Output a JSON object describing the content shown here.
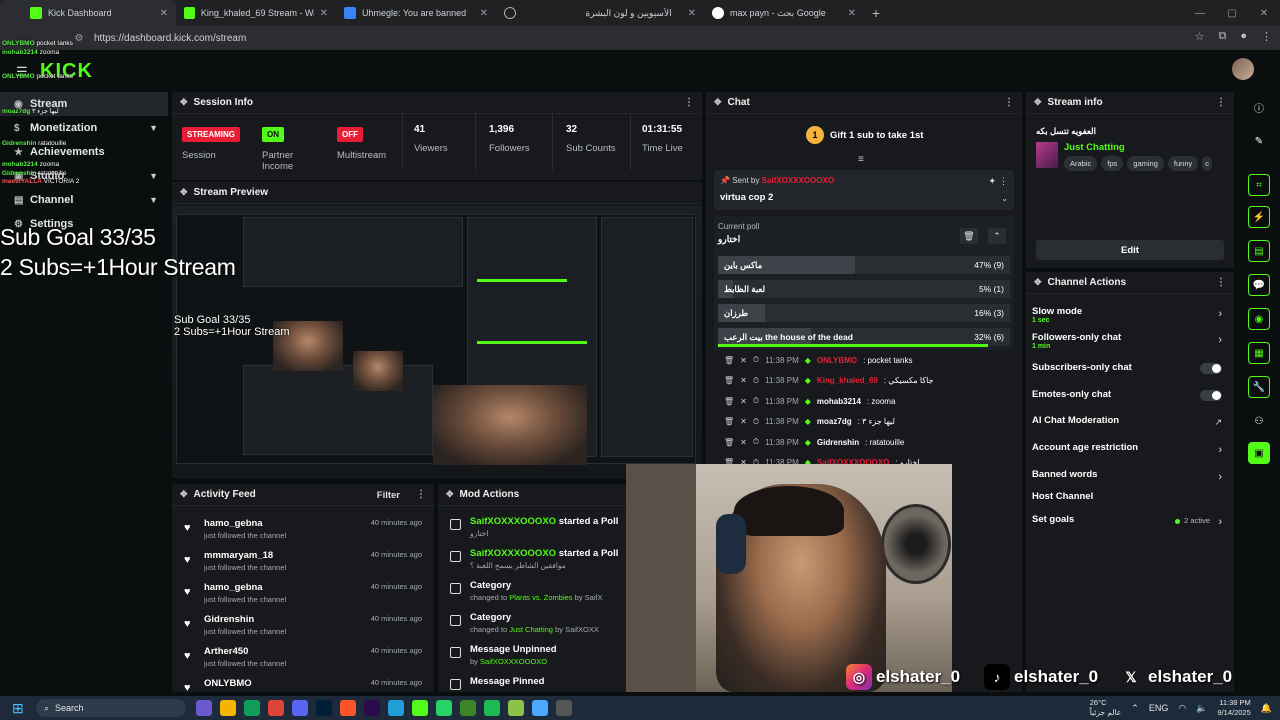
{
  "browser": {
    "tabs": [
      {
        "label": "Kick Dashboard",
        "active": true
      },
      {
        "label": "King_khaled_69 Stream - Watc"
      },
      {
        "label": "Uhmegle: You are banned"
      },
      {
        "label": ""
      },
      {
        "label": "الأسيويين و لون البشرة"
      },
      {
        "label": "max payn - بحث Google"
      }
    ],
    "url": "https://dashboard.kick.com/stream"
  },
  "kick": {
    "logo": "KICK"
  },
  "overlay_chat": [
    {
      "user": "ONLYBMO",
      "msg": "pocket tanks"
    },
    {
      "user": "mohab3214",
      "msg": "zooma"
    },
    {
      "user": "ONLYBMO",
      "msg": "pocket tanks"
    },
    {
      "user": "moaz7dg",
      "msg": "ليها جزء ٣"
    },
    {
      "user": "Gidrenshin",
      "msg": "ratatouille"
    },
    {
      "user": "mohab3214",
      "msg": "zooma"
    },
    {
      "user": "Gidrenshin",
      "msg": "ratatouille"
    },
    {
      "user": "maestYALLA",
      "msg": "VICTORIA 2"
    }
  ],
  "sub_goal": {
    "line1": "Sub Goal 33/35",
    "line2": "2 Subs=+1Hour Stream"
  },
  "sidebar": {
    "items": [
      {
        "label": "Stream"
      },
      {
        "label": "Monetization"
      },
      {
        "label": "Achievements"
      },
      {
        "label": "Studio"
      },
      {
        "label": "Channel"
      },
      {
        "label": "Settings"
      }
    ]
  },
  "session": {
    "title": "Session Info",
    "streaming_pill": "STREAMING",
    "session_label": "Session",
    "partner_pill": "ON",
    "partner_label": "Partner Income",
    "multistream_pill": "OFF",
    "multistream_label": "Multistream",
    "viewers": "41",
    "viewers_label": "Viewers",
    "followers": "1,396",
    "followers_label": "Followers",
    "subs": "32",
    "subs_label": "Sub Counts",
    "time": "01:31:55",
    "time_label": "Time Live"
  },
  "preview": {
    "title": "Stream Preview",
    "sub1": "Sub Goal 33/35",
    "sub2": "2 Subs=+1Hour Stream"
  },
  "activity": {
    "title": "Activity Feed",
    "filter": "Filter",
    "rows": [
      {
        "name": "hamo_gebna",
        "sub": "just followed the channel",
        "time": "40 minutes ago"
      },
      {
        "name": "mmmaryam_18",
        "sub": "just followed the channel",
        "time": "40 minutes ago"
      },
      {
        "name": "hamo_gebna",
        "sub": "just followed the channel",
        "time": "40 minutes ago"
      },
      {
        "name": "Gidrenshin",
        "sub": "just followed the channel",
        "time": "40 minutes ago"
      },
      {
        "name": "Arther450",
        "sub": "just followed the channel",
        "time": "40 minutes ago"
      },
      {
        "name": "ONLYBMO",
        "sub": "",
        "time": "40 minutes ago"
      }
    ]
  },
  "mod": {
    "title": "Mod Actions",
    "rows": [
      {
        "t1a": "SaifXOXXXOOOXO",
        "t1b": " started a Poll",
        "t2": "اختارو"
      },
      {
        "t1a": "SaifXOXXXOOOXO",
        "t1b": " started a Poll",
        "t2": "موافقين الشاطر يسمح اللعبة ؟"
      },
      {
        "t1a": "",
        "t1b": "Category",
        "t2a": "changed to ",
        "t2b": "Plants vs. Zombies",
        "t2c": " by SaifX"
      },
      {
        "t1a": "",
        "t1b": "Category",
        "t2a": "changed to ",
        "t2b": "Just Chatting",
        "t2c": " by SaifXOXX"
      },
      {
        "t1a": "",
        "t1b": "Message Unpinned",
        "t2a": "by ",
        "t2b": "SaifXOXXXOOOXO",
        "t2c": ""
      },
      {
        "t1a": "",
        "t1b": "Message Pinned",
        "t2a": "",
        "t2b": "",
        "t2c": ""
      }
    ]
  },
  "chat": {
    "title": "Chat",
    "gift": "Gift 1 sub to take 1st",
    "gift_count": "1",
    "pinned_by": "Sent by",
    "pinned_user": "SaifXOXXXOOOXO",
    "pinned_msg": "virtua cop 2",
    "poll_label": "Current poll",
    "poll_question": "اختارو",
    "poll_options": [
      {
        "label": "ماكس باين",
        "pct": "47% (9)",
        "fraction": 0.47
      },
      {
        "label": "لعبة الظابط",
        "pct": "5% (1)",
        "fraction": 0.05
      },
      {
        "label": "طرزان",
        "pct": "16% (3)",
        "fraction": 0.16
      },
      {
        "label": "بيت الرعب the house of the dead",
        "pct": "32% (6)",
        "fraction": 0.32
      }
    ],
    "messages": [
      {
        "time": "11:38 PM",
        "user": "ONLYBMO",
        "msg": ": pocket tanks",
        "color": "#e91e36"
      },
      {
        "time": "11:38 PM",
        "user": "King_khaled_69",
        "msg": ": جاكا مكسيكي",
        "color": "#e91e36"
      },
      {
        "time": "11:38 PM",
        "user": "mohab3214",
        "msg": ": zooma",
        "color": "#ffffff"
      },
      {
        "time": "11:38 PM",
        "user": "moaz7dg",
        "msg": ": ليها جزء ٣",
        "color": "#ffffff"
      },
      {
        "time": "11:38 PM",
        "user": "Gidrenshin",
        "msg": ": ratatouille",
        "color": "#ffffff"
      },
      {
        "time": "11:38 PM",
        "user": "SaifXOXXXOOOXO",
        "msg": ": اختارو",
        "color": "#e91e36"
      }
    ]
  },
  "stream_info": {
    "title": "Stream info",
    "stream_title": "العفويه تتسل بكه",
    "category": "Just Chatting",
    "tags": [
      "Arabic",
      "fps",
      "gaming",
      "funny",
      "c"
    ],
    "edit": "Edit"
  },
  "channel_actions": {
    "title": "Channel Actions",
    "slow_mode": "Slow mode",
    "slow_sub": "1 sec",
    "followers_only": "Followers-only chat",
    "followers_sub": "1 min",
    "subs_only": "Subscribers-only chat",
    "emotes_only": "Emotes-only chat",
    "ai_mod": "AI Chat Moderation",
    "age": "Account age restriction",
    "banned": "Banned words",
    "host": "Host Channel",
    "goals": "Set goals",
    "goals_active": "2 active"
  },
  "watermarks": {
    "ig": "elshater_0",
    "tt": "elshater_0",
    "x": "elshater_0"
  },
  "taskbar": {
    "search": "Search",
    "weather": "26°C",
    "weather_sub": "عالم جزئياً",
    "lang": "ENG",
    "time": "11:38 PM",
    "date": "9/14/2025"
  },
  "colors": {
    "accent": "#53fc18",
    "live_red": "#e91e36"
  }
}
